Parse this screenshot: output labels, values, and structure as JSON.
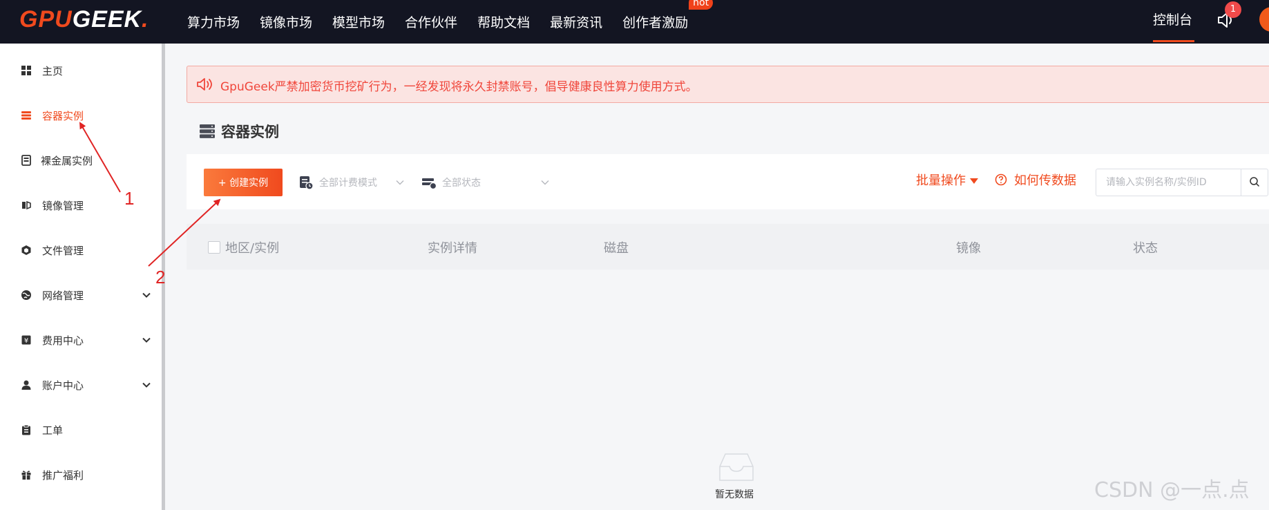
{
  "header": {
    "logo": {
      "gpu": "GPU",
      "geek": "GEEK",
      "dot": "."
    },
    "nav": [
      {
        "label": "算力市场"
      },
      {
        "label": "镜像市场"
      },
      {
        "label": "模型市场"
      },
      {
        "label": "合作伙伴"
      },
      {
        "label": "帮助文档"
      },
      {
        "label": "最新资讯"
      },
      {
        "label": "创作者激励",
        "badge": "hot"
      }
    ],
    "console_label": "控制台",
    "notification_count": "1"
  },
  "sidebar": {
    "items": [
      {
        "label": "主页",
        "icon": "grid-icon"
      },
      {
        "label": "容器实例",
        "icon": "server-icon",
        "active": true
      },
      {
        "label": "裸金属实例",
        "icon": "machine-icon"
      },
      {
        "label": "镜像管理",
        "icon": "image-icon"
      },
      {
        "label": "文件管理",
        "icon": "box-icon"
      },
      {
        "label": "网络管理",
        "icon": "globe-icon",
        "expandable": true
      },
      {
        "label": "费用中心",
        "icon": "yen-icon",
        "expandable": true
      },
      {
        "label": "账户中心",
        "icon": "user-icon",
        "expandable": true
      },
      {
        "label": "工单",
        "icon": "clipboard-icon"
      },
      {
        "label": "推广福利",
        "icon": "gift-icon"
      }
    ]
  },
  "notice": {
    "text": "GpuGeek严禁加密货币挖矿行为，一经发现将永久封禁账号，倡导健康良性算力使用方式。"
  },
  "page": {
    "title": "容器实例"
  },
  "toolbar": {
    "create_label": "+ 创建实例",
    "billing_filter": "全部计费模式",
    "status_filter": "全部状态",
    "batch_label": "批量操作",
    "howto_label": "如何传数据",
    "search_placeholder": "请输入实例名称/实例ID"
  },
  "table": {
    "columns": [
      "地区/实例",
      "实例详情",
      "磁盘",
      "镜像",
      "状态"
    ],
    "empty_text": "暂无数据"
  },
  "annotations": [
    "1",
    "2"
  ],
  "watermark": "CSDN @一点.点",
  "colors": {
    "accent": "#f04a1e",
    "topbar": "#131522",
    "notice_bg": "#fbe4e2",
    "notice_text": "#f0463b",
    "annotation": "#e02424"
  }
}
